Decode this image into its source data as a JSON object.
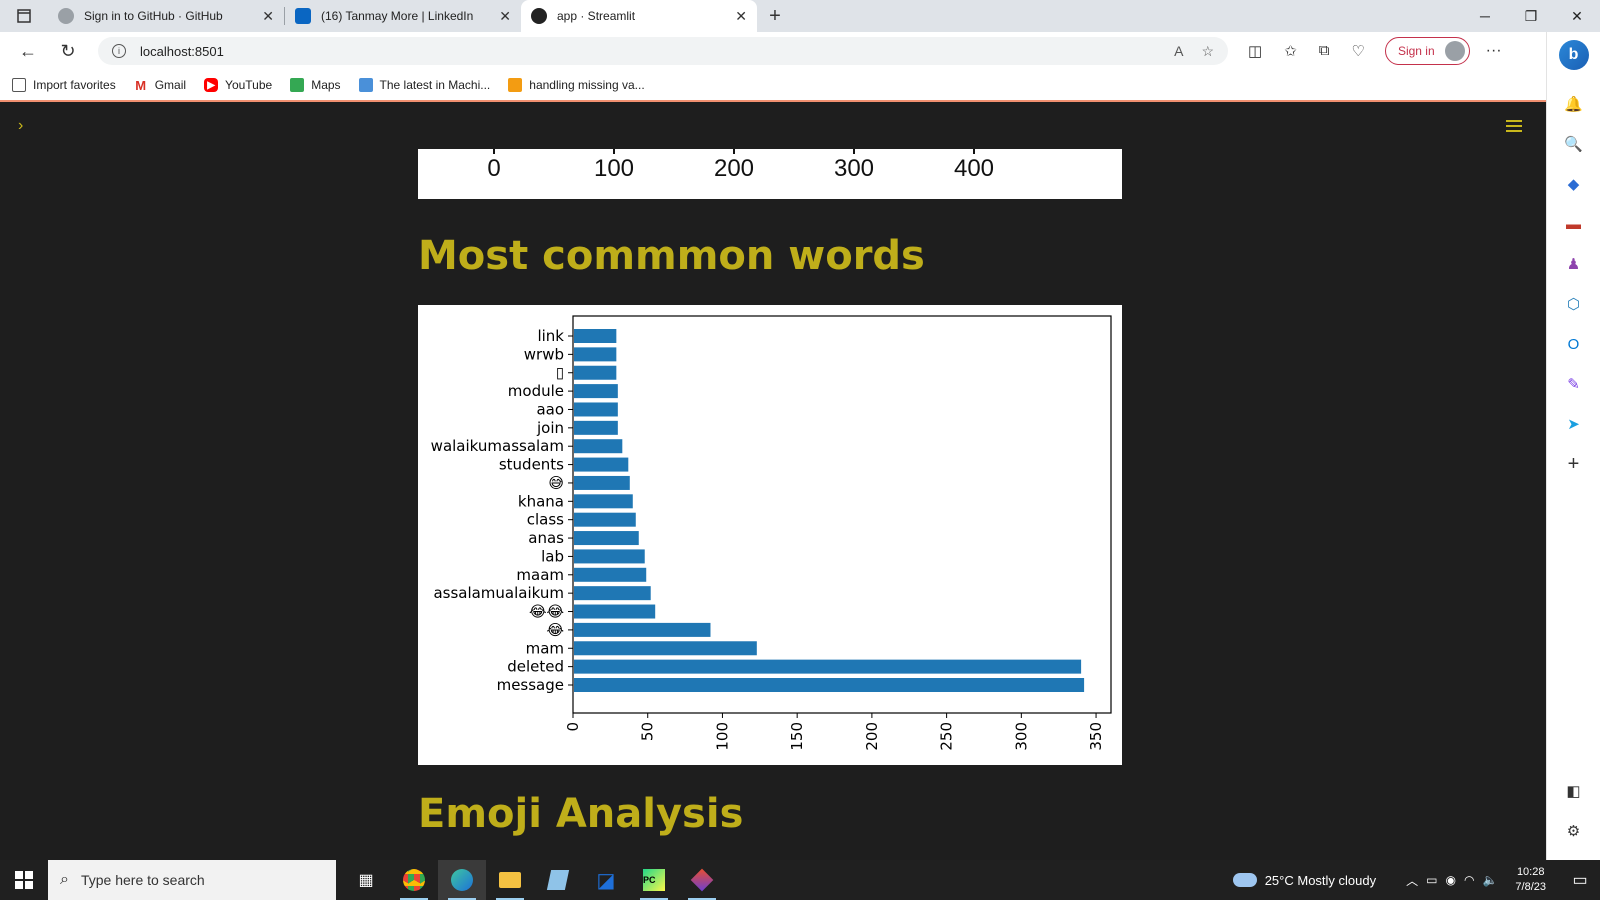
{
  "browser": {
    "tabs": [
      {
        "title": "Sign in to GitHub · GitHub",
        "icon": "github-icon",
        "active": false
      },
      {
        "title": "(16) Tanmay More | LinkedIn",
        "icon": "linkedin-icon",
        "active": false
      },
      {
        "title": "app · Streamlit",
        "icon": "streamlit-icon",
        "active": true
      }
    ],
    "url": "localhost:8501",
    "signin_label": "Sign in",
    "bookmarks": [
      {
        "label": "Import favorites",
        "icon": "import-icon",
        "color": "#555555"
      },
      {
        "label": "Gmail",
        "icon": "gmail-icon",
        "color": "#d93025"
      },
      {
        "label": "YouTube",
        "icon": "youtube-icon",
        "color": "#ff0000"
      },
      {
        "label": "Maps",
        "icon": "maps-icon",
        "color": "#34a853"
      },
      {
        "label": "The latest in Machi...",
        "icon": "news-icon",
        "color": "#4a90d9"
      },
      {
        "label": "handling missing va...",
        "icon": "book-icon",
        "color": "#f39c12"
      }
    ]
  },
  "page": {
    "top_chart_ticks": [
      "0",
      "100",
      "200",
      "300",
      "400"
    ],
    "heading_common_words": "Most commmon words",
    "heading_emoji": "Emoji Analysis",
    "accent_color": "#bfae1a"
  },
  "chart_data": {
    "type": "bar",
    "orientation": "horizontal",
    "categories": [
      "message",
      "deleted",
      "mam",
      "😂",
      "😂😂",
      "assalamualaikum",
      "maam",
      "lab",
      "anas",
      "class",
      "khana",
      "😅",
      "students",
      "walaikumassalam",
      "join",
      "aao",
      "module",
      "▯",
      "wrwb",
      "link"
    ],
    "values": [
      342,
      340,
      123,
      92,
      55,
      52,
      49,
      48,
      44,
      42,
      40,
      38,
      37,
      33,
      30,
      30,
      30,
      29,
      29,
      29
    ],
    "xlim": [
      0,
      360
    ],
    "xticks": [
      0,
      50,
      100,
      150,
      200,
      250,
      300,
      350
    ],
    "bar_color": "#1f77b4",
    "grid": false
  },
  "taskbar": {
    "search_placeholder": "Type here to search",
    "weather": "25°C  Mostly cloudy",
    "time": "10:28",
    "date": "7/8/23"
  }
}
